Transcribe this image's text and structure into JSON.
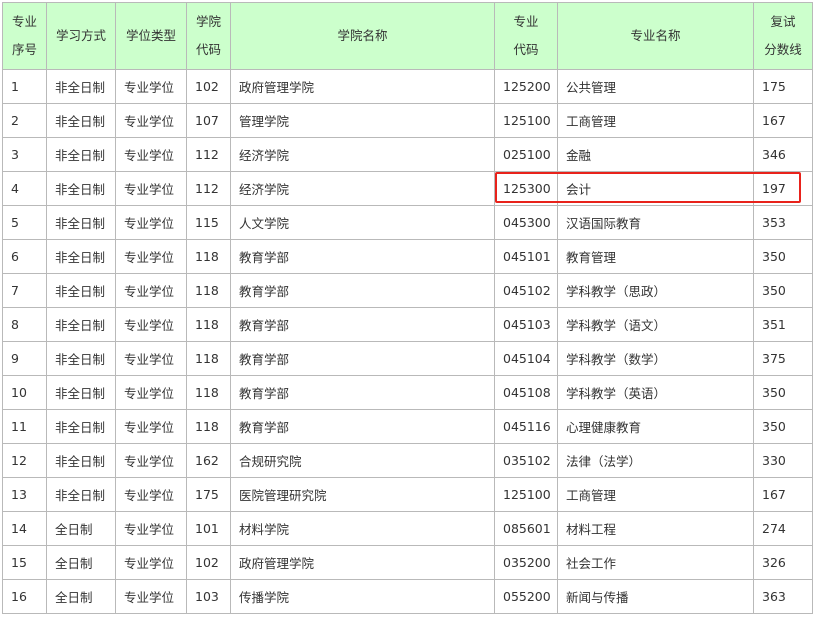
{
  "table": {
    "headers": [
      {
        "l1": "专业",
        "l2": "序号"
      },
      {
        "l1": "学习方式",
        "l2": ""
      },
      {
        "l1": "学位类型",
        "l2": ""
      },
      {
        "l1": "学院",
        "l2": "代码"
      },
      {
        "l1": "学院名称",
        "l2": ""
      },
      {
        "l1": "专业",
        "l2": "代码"
      },
      {
        "l1": "专业名称",
        "l2": ""
      },
      {
        "l1": "复试",
        "l2": "分数线"
      }
    ],
    "rows": [
      [
        "1",
        "非全日制",
        "专业学位",
        "102",
        "政府管理学院",
        "125200",
        "公共管理",
        "175"
      ],
      [
        "2",
        "非全日制",
        "专业学位",
        "107",
        "管理学院",
        "125100",
        "工商管理",
        "167"
      ],
      [
        "3",
        "非全日制",
        "专业学位",
        "112",
        "经济学院",
        "025100",
        "金融",
        "346"
      ],
      [
        "4",
        "非全日制",
        "专业学位",
        "112",
        "经济学院",
        "125300",
        "会计",
        "197"
      ],
      [
        "5",
        "非全日制",
        "专业学位",
        "115",
        "人文学院",
        "045300",
        "汉语国际教育",
        "353"
      ],
      [
        "6",
        "非全日制",
        "专业学位",
        "118",
        "教育学部",
        "045101",
        "教育管理",
        "350"
      ],
      [
        "7",
        "非全日制",
        "专业学位",
        "118",
        "教育学部",
        "045102",
        "学科教学（思政）",
        "350"
      ],
      [
        "8",
        "非全日制",
        "专业学位",
        "118",
        "教育学部",
        "045103",
        "学科教学（语文）",
        "351"
      ],
      [
        "9",
        "非全日制",
        "专业学位",
        "118",
        "教育学部",
        "045104",
        "学科教学（数学）",
        "375"
      ],
      [
        "10",
        "非全日制",
        "专业学位",
        "118",
        "教育学部",
        "045108",
        "学科教学（英语）",
        "350"
      ],
      [
        "11",
        "非全日制",
        "专业学位",
        "118",
        "教育学部",
        "045116",
        "心理健康教育",
        "350"
      ],
      [
        "12",
        "非全日制",
        "专业学位",
        "162",
        "合规研究院",
        "035102",
        "法律（法学）",
        "330"
      ],
      [
        "13",
        "非全日制",
        "专业学位",
        "175",
        "医院管理研究院",
        "125100",
        "工商管理",
        "167"
      ],
      [
        "14",
        "全日制",
        "专业学位",
        "101",
        "材料学院",
        "085601",
        "材料工程",
        "274"
      ],
      [
        "15",
        "全日制",
        "专业学位",
        "102",
        "政府管理学院",
        "035200",
        "社会工作",
        "326"
      ],
      [
        "16",
        "全日制",
        "专业学位",
        "103",
        "传播学院",
        "055200",
        "新闻与传播",
        "363"
      ]
    ],
    "highlight_row_index": 3,
    "highlight_color": "#e8221b",
    "header_bg": "#ccffcc"
  }
}
